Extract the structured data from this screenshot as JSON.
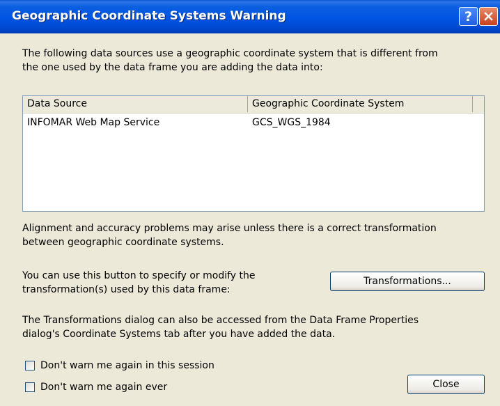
{
  "window": {
    "title": "Geographic Coordinate Systems Warning",
    "help_label": "?"
  },
  "intro": {
    "line1": "The following data sources use a geographic coordinate system that is different from",
    "line2": "the one used by the data frame you are adding the data into:"
  },
  "table": {
    "columns": [
      "Data Source",
      "Geographic Coordinate System"
    ],
    "rows": [
      [
        "INFOMAR Web Map Service",
        "GCS_WGS_1984"
      ]
    ]
  },
  "alignment": {
    "line1": "Alignment and accuracy problems may arise unless there is a correct transformation",
    "line2": "between geographic coordinate systems."
  },
  "transform_hint": {
    "line1": "You can use this button to specify or modify the",
    "line2": "transformation(s) used by this data frame:"
  },
  "buttons": {
    "transformations": "Transformations...",
    "close": "Close"
  },
  "note": {
    "line1": "The Transformations dialog can also be accessed from the Data Frame Properties",
    "line2": "dialog's Coordinate Systems tab after you have added the data."
  },
  "checkboxes": {
    "session": {
      "label": "Don't warn me again in this session",
      "checked": false
    },
    "ever": {
      "label": "Don't warn me again ever",
      "checked": false
    }
  }
}
